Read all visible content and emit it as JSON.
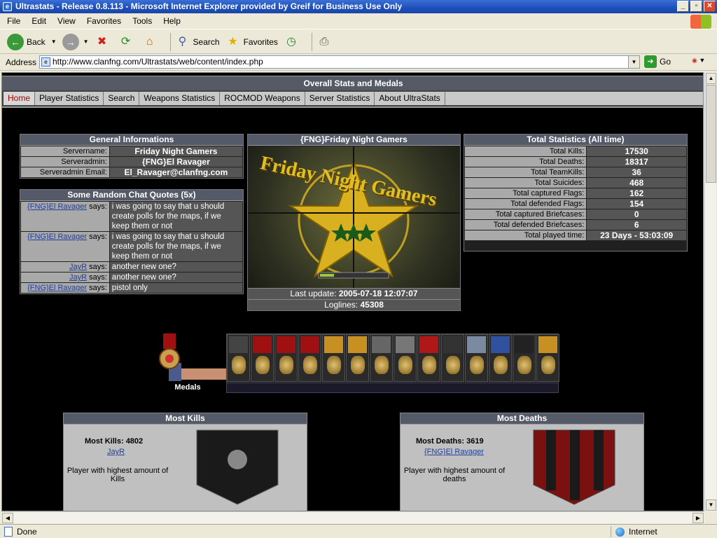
{
  "window": {
    "title": "Ultrastats - Release 0.8.113 - Microsoft Internet Explorer provided by Greif for Business Use Only"
  },
  "menu": [
    "File",
    "Edit",
    "View",
    "Favorites",
    "Tools",
    "Help"
  ],
  "toolbar": {
    "back": "Back",
    "search": "Search",
    "favorites": "Favorites"
  },
  "address": {
    "label": "Address",
    "url": "http://www.clanfng.com/Ultrastats/web/content/index.php",
    "go": "Go"
  },
  "status": {
    "left": "Done",
    "zone": "Internet"
  },
  "page": {
    "header": "Overall Stats and Medals",
    "nav": [
      "Home",
      "Player Statistics",
      "Search",
      "Weapons Statistics",
      "ROCMOD Weapons",
      "Server Statistics",
      "About UltraStats"
    ],
    "general": {
      "title": "General Informations",
      "rows": [
        {
          "label": "Servername:",
          "value": "Friday Night Gamers"
        },
        {
          "label": "Serveradmin:",
          "value": "{FNG}El Ravager"
        },
        {
          "label": "Serveradmin Email:",
          "value": "El_Ravager@clanfng.com"
        }
      ]
    },
    "quotes": {
      "title": "Some Random Chat Quotes (5x)",
      "says": "says:",
      "rows": [
        {
          "player": "{FNG}El Ravager",
          "text": "i was going to say that u should create polls for the maps, if we keep them or not"
        },
        {
          "player": "{FNG}El Ravager",
          "text": "i was going to say that u should create polls for the maps, if we keep them or not"
        },
        {
          "player": "JayR",
          "text": "another new one?"
        },
        {
          "player": "JayR",
          "text": "another new one?"
        },
        {
          "player": "{FNG}El Ravager",
          "text": "pistol only"
        }
      ]
    },
    "server": {
      "title": "{FNG}Friday Night Gamers",
      "banner_text": "Friday Night Gamers",
      "last_update_label": "Last update:",
      "last_update": "2005-07-18 12:07:07",
      "loglines_label": "Loglines:",
      "loglines": "45308"
    },
    "totals": {
      "title": "Total Statistics (All time)",
      "rows": [
        {
          "label": "Total Kills:",
          "value": "17530"
        },
        {
          "label": "Total Deaths:",
          "value": "18317"
        },
        {
          "label": "Total TeamKills:",
          "value": "36"
        },
        {
          "label": "Total Suicides:",
          "value": "468"
        },
        {
          "label": "Total captured Flags:",
          "value": "162"
        },
        {
          "label": "Total defended Flags:",
          "value": "154"
        },
        {
          "label": "Total captured Briefcases:",
          "value": "0"
        },
        {
          "label": "Total defended Briefcases:",
          "value": "6"
        },
        {
          "label": "Total played time:",
          "value": "23 Days - 53:03:09"
        }
      ]
    },
    "medals_label": "Medals",
    "medal_colors": [
      "#444",
      "#a01010",
      "#a01010",
      "#a01010",
      "#c89020",
      "#c89020",
      "#666",
      "#777",
      "#b01818",
      "#333",
      "#7a8aa0",
      "#3050a0",
      "#222",
      "#c89020"
    ],
    "most_kills": {
      "title": "Most Kills",
      "stat_label": "Most Kills:",
      "stat_value": "4802",
      "player": "JayR",
      "desc": "Player with highest amount of Kills"
    },
    "most_deaths": {
      "title": "Most Deaths",
      "stat_label": "Most Deaths:",
      "stat_value": "3619",
      "player": "{FNG}El Ravager",
      "desc": "Player with highest amount of deaths"
    }
  }
}
